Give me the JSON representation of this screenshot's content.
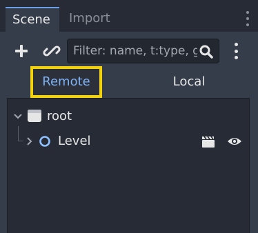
{
  "tabs": [
    {
      "label": "Scene",
      "active": true
    },
    {
      "label": "Import",
      "active": false
    }
  ],
  "toolbar": {
    "add_icon": "plus-icon",
    "link_icon": "link-icon",
    "filter_placeholder": "Filter: name, t:type, g",
    "search_icon": "search-icon",
    "menu_icon": "kebab-menu-icon"
  },
  "view_toggle": {
    "remote_label": "Remote",
    "local_label": "Local",
    "selected": "Remote"
  },
  "tree": {
    "root": {
      "label": "root",
      "expanded": true,
      "icon": "folder-icon"
    },
    "children": [
      {
        "label": "Level",
        "expanded": false,
        "icon": "node3d-circle-icon",
        "badges": [
          "clapperboard-icon",
          "eye-icon"
        ]
      }
    ]
  },
  "colors": {
    "accent": "#7fb2f4",
    "highlight": "#f4d20b",
    "panel": "#363d4a",
    "tree_bg": "#262b35"
  }
}
